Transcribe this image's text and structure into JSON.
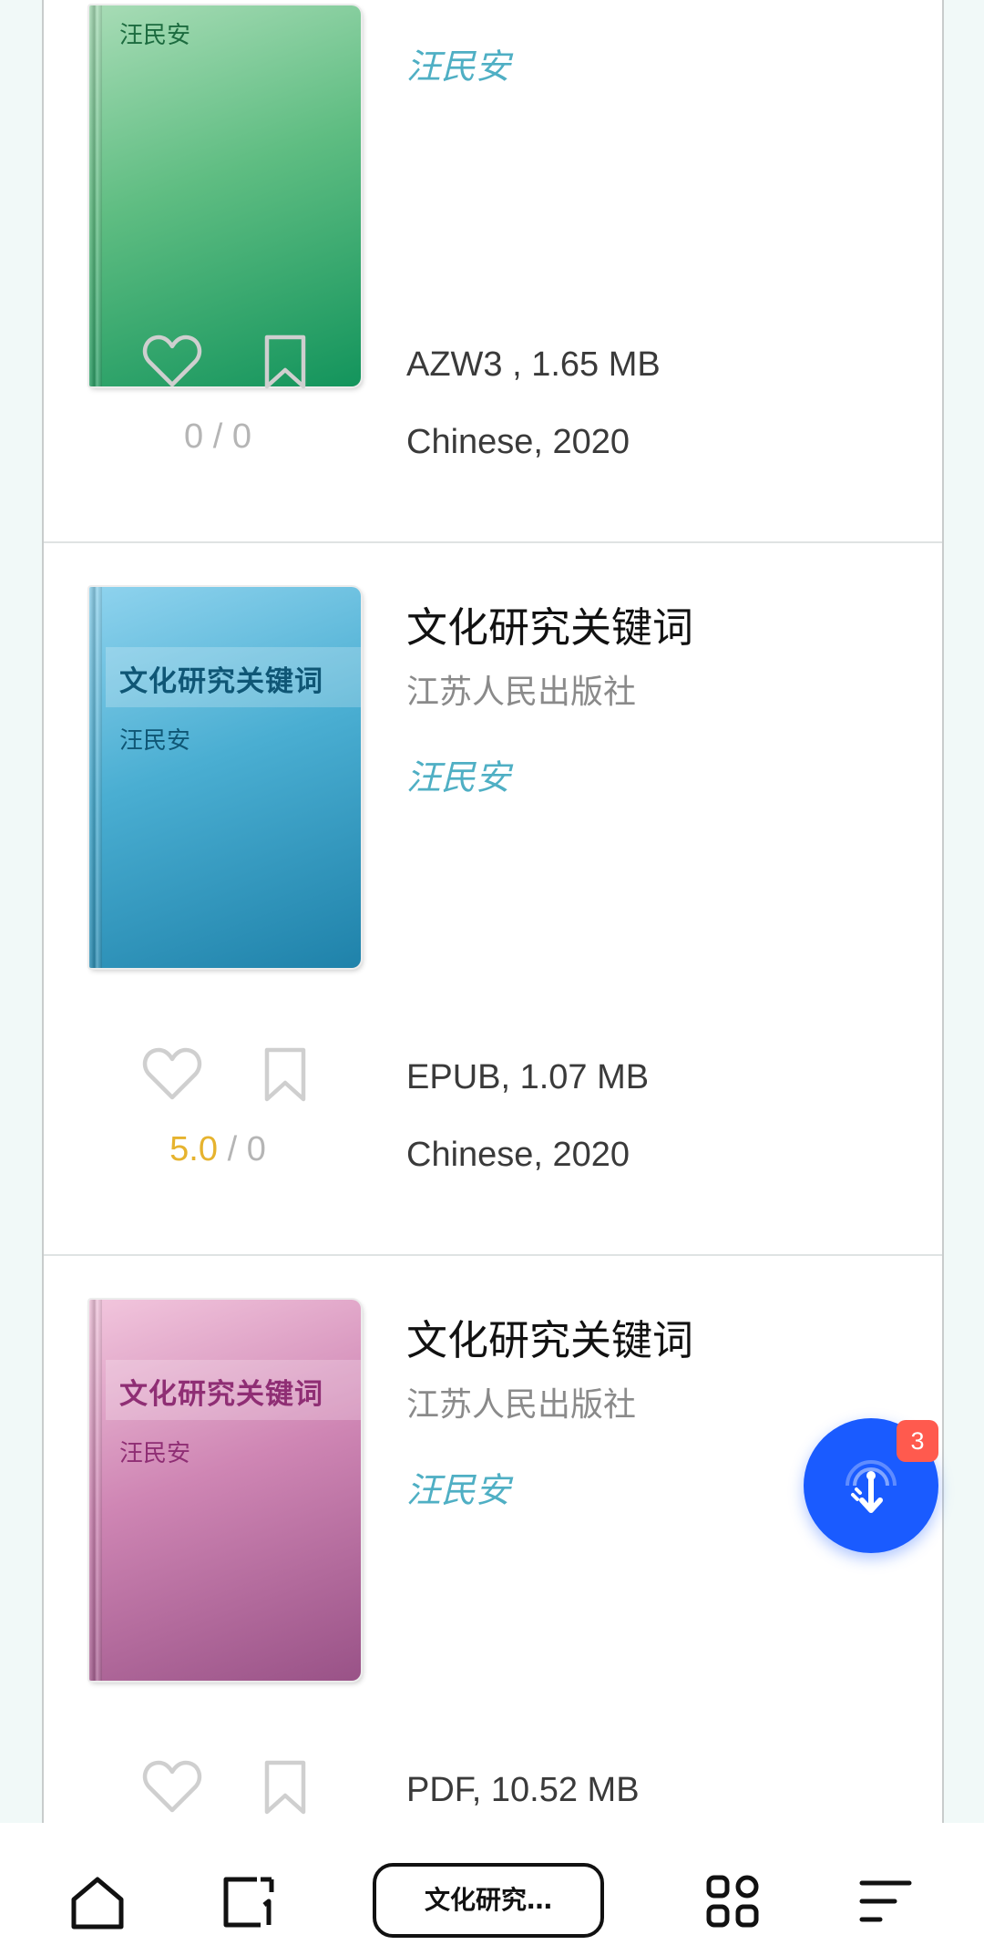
{
  "books": [
    {
      "title": "",
      "publisher": "",
      "author": "汪民安",
      "cover_title": "",
      "cover_author": "汪民安",
      "format_size": "AZW3 , 1.65 MB",
      "language_year": "Chinese, 2020",
      "rating_score": "0",
      "rating_count": "0"
    },
    {
      "title": "文化研究关键词",
      "publisher": "江苏人民出版社",
      "author": "汪民安",
      "cover_title": "文化研究关键词",
      "cover_author": "汪民安",
      "format_size": "EPUB, 1.07 MB",
      "language_year": "Chinese, 2020",
      "rating_score": "5.0",
      "rating_count": "0"
    },
    {
      "title": "文化研究关键词",
      "publisher": "江苏人民出版社",
      "author": "汪民安",
      "cover_title": "文化研究关键词",
      "cover_author": "汪民安",
      "format_size": "PDF, 10.52 MB",
      "language_year": "",
      "rating_score": "",
      "rating_count": ""
    }
  ],
  "rating_separator": "/",
  "fab": {
    "badge": "3",
    "icon": "touch-tap-icon",
    "color": "#1a5bff"
  },
  "colors": {
    "author": "#4fafc4",
    "rating_gold": "#e6b32e",
    "badge": "#ff5a4e"
  },
  "bottom_nav": {
    "items": [
      "home-icon",
      "tabs-icon",
      "current-page",
      "apps-icon",
      "menu-icon"
    ],
    "current_label": "文化研究…"
  }
}
